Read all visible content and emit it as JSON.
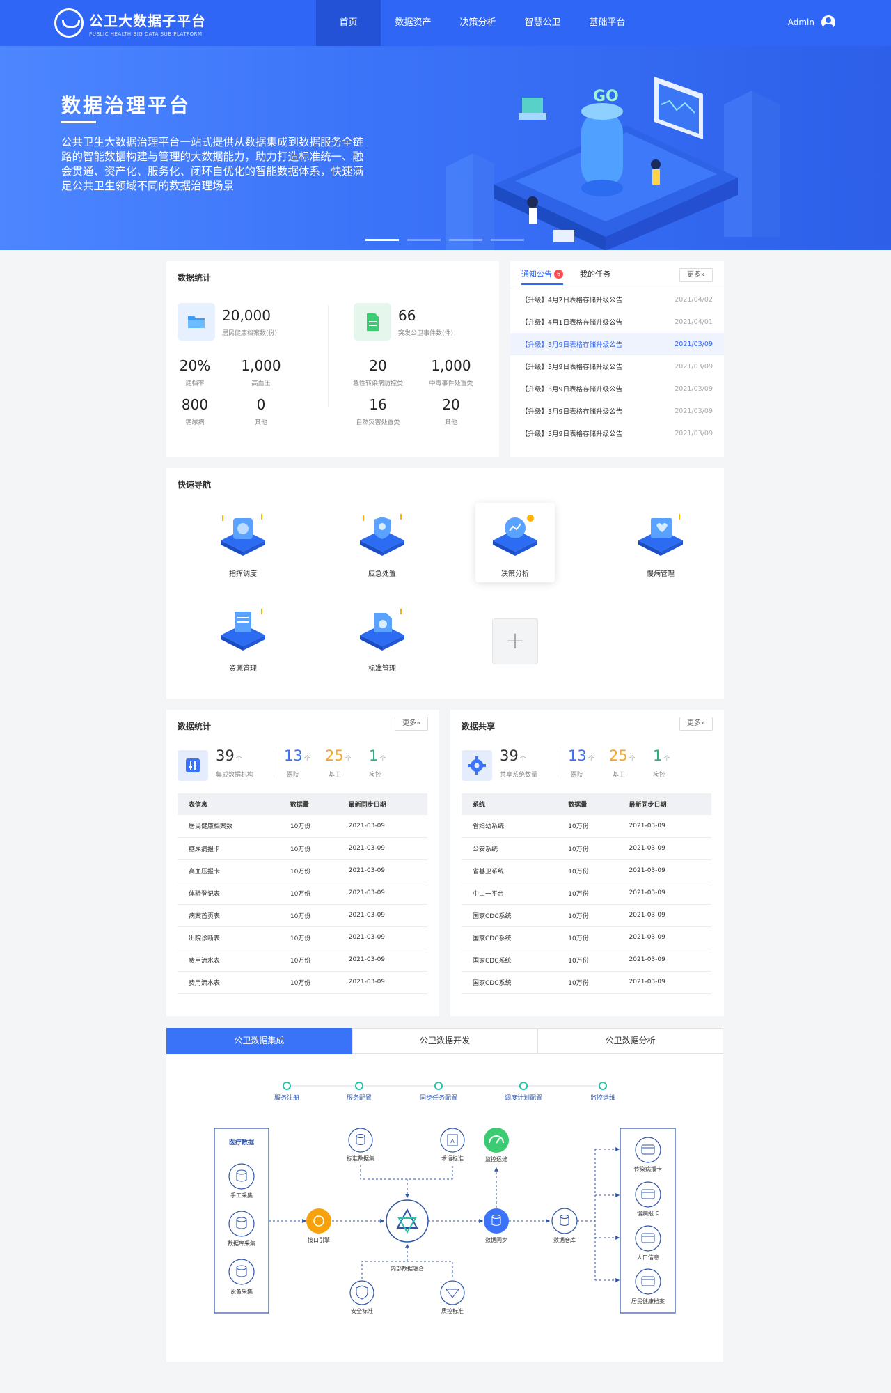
{
  "header": {
    "logo_cn": "公卫大数据子平台",
    "logo_en": "PUBLIC HEALTH BIG DATA SUB PLATFORM",
    "nav": [
      "首页",
      "数据资产",
      "决策分析",
      "智慧公卫",
      "基础平台"
    ],
    "user": "Admin"
  },
  "banner": {
    "title": "数据治理平台",
    "desc": "公共卫生大数据治理平台一站式提供从数据集成到数据服务全链路的智能数据构建与管理的大数据能力，助力打造标准统一、融会贯通、资产化、服务化、闭环自优化的智能数据体系，快速满足公共卫生领域不同的数据治理场景",
    "active_dot": 1
  },
  "stats": {
    "title": "数据统计",
    "left": {
      "main_value": "20,000",
      "main_label": "居民健康档案数(份)",
      "cells": [
        {
          "value": "20%",
          "label": "建档率"
        },
        {
          "value": "1,000",
          "label": "高血压"
        },
        {
          "value": "800",
          "label": "糖尿病"
        },
        {
          "value": "0",
          "label": "其他"
        }
      ]
    },
    "right": {
      "main_value": "66",
      "main_label": "突发公卫事件数(件)",
      "cells": [
        {
          "value": "20",
          "label": "急性转染病防控类"
        },
        {
          "value": "1,000",
          "label": "中毒事件处置类"
        },
        {
          "value": "16",
          "label": "自然灾害处置类"
        },
        {
          "value": "20",
          "label": "其他"
        }
      ]
    }
  },
  "notice": {
    "tab_active": "通知公告",
    "badge": "6",
    "tab_other": "我的任务",
    "more": "更多»",
    "items": [
      {
        "title": "【升级】4月2日表格存储升级公告",
        "date": "2021/04/02"
      },
      {
        "title": "【升级】4月1日表格存储升级公告",
        "date": "2021/04/01"
      },
      {
        "title": "【升级】3月9日表格存储升级公告",
        "date": "2021/03/09"
      },
      {
        "title": "【升级】3月9日表格存储升级公告",
        "date": "2021/03/09"
      },
      {
        "title": "【升级】3月9日表格存储升级公告",
        "date": "2021/03/09"
      },
      {
        "title": "【升级】3月9日表格存储升级公告",
        "date": "2021/03/09"
      },
      {
        "title": "【升级】3月9日表格存储升级公告",
        "date": "2021/03/09"
      }
    ]
  },
  "quicknav": {
    "title": "快速导航",
    "items": [
      "指挥调度",
      "应急处置",
      "决策分析",
      "慢病管理",
      "资源管理",
      "标准管理"
    ],
    "plus": "+"
  },
  "data_stats": {
    "title": "数据统计",
    "more": "更多»",
    "main_value": "39",
    "main_label": "集成数据机构",
    "arrow": "个",
    "subs": [
      {
        "value": "13",
        "label": "医院",
        "color": "#3b73f8"
      },
      {
        "value": "25",
        "label": "基卫",
        "color": "#f5a623"
      },
      {
        "value": "1",
        "label": "疾控",
        "color": "#2ab27b"
      }
    ],
    "headers": [
      "表信息",
      "数据量",
      "最新同步日期"
    ],
    "rows": [
      [
        "居民健康档案数",
        "10万份",
        "2021-03-09"
      ],
      [
        "糖尿病报卡",
        "10万份",
        "2021-03-09"
      ],
      [
        "高血压报卡",
        "10万份",
        "2021-03-09"
      ],
      [
        "体验登记表",
        "10万份",
        "2021-03-09"
      ],
      [
        "病案首页表",
        "10万份",
        "2021-03-09"
      ],
      [
        "出院诊断表",
        "10万份",
        "2021-03-09"
      ],
      [
        "费用流水表",
        "10万份",
        "2021-03-09"
      ],
      [
        "费用流水表",
        "10万份",
        "2021-03-09"
      ]
    ]
  },
  "data_share": {
    "title": "数据共享",
    "more": "更多»",
    "main_value": "39",
    "main_label": "共享系统数量",
    "arrow": "个",
    "subs": [
      {
        "value": "13",
        "label": "医院",
        "color": "#3b73f8"
      },
      {
        "value": "25",
        "label": "基卫",
        "color": "#f5a623"
      },
      {
        "value": "1",
        "label": "疾控",
        "color": "#2ab27b"
      }
    ],
    "headers": [
      "系统",
      "数据量",
      "最新同步日期"
    ],
    "rows": [
      [
        "省妇幼系统",
        "10万份",
        "2021-03-09"
      ],
      [
        "公安系统",
        "10万份",
        "2021-03-09"
      ],
      [
        "省基卫系统",
        "10万份",
        "2021-03-09"
      ],
      [
        "中山一平台",
        "10万份",
        "2021-03-09"
      ],
      [
        "国家CDC系统",
        "10万份",
        "2021-03-09"
      ],
      [
        "国家CDC系统",
        "10万份",
        "2021-03-09"
      ],
      [
        "国家CDC系统",
        "10万份",
        "2021-03-09"
      ],
      [
        "国家CDC系统",
        "10万份",
        "2021-03-09"
      ]
    ]
  },
  "process": {
    "tabs": [
      "公卫数据集成",
      "公卫数据开发",
      "公卫数据分析"
    ],
    "active_tab": 0,
    "steps": [
      "服务注册",
      "服务配置",
      "同步任务配置",
      "调度计划配置",
      "监控运维"
    ],
    "source_box_title": "医疗数据",
    "sources": [
      "手工采集",
      "数据库采集",
      "设备采集"
    ],
    "top_nodes": [
      "标准数据集",
      "术语标准",
      "监控运维"
    ],
    "gateway": "接口引擎",
    "sync": "数据同步",
    "warehouse": "数据仓库",
    "bottom_title": "内部数据融合",
    "bottom_nodes": [
      "安全标准",
      "质控标准"
    ],
    "outputs": [
      "传染病报卡",
      "慢病报卡",
      "人口信息",
      "居民健康档案"
    ]
  }
}
